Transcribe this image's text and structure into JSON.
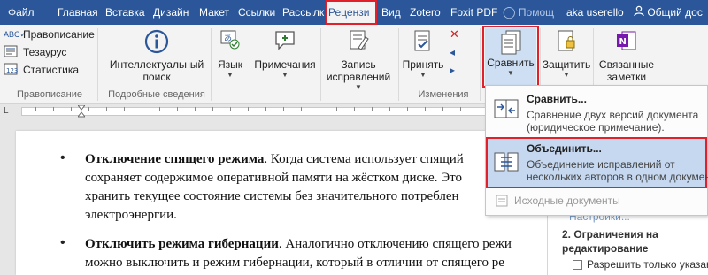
{
  "tabs": [
    {
      "label": "Файл",
      "active": false
    },
    {
      "label": "Главная",
      "active": false
    },
    {
      "label": "Вставка",
      "active": false
    },
    {
      "label": "Дизайн",
      "active": false
    },
    {
      "label": "Макет",
      "active": false
    },
    {
      "label": "Ссылки",
      "active": false
    },
    {
      "label": "Рассылк",
      "active": false
    },
    {
      "label": "Рецензи",
      "active": true
    },
    {
      "label": "Вид",
      "active": false
    },
    {
      "label": "Zotero",
      "active": false
    },
    {
      "label": "Foxit PDF",
      "active": false
    }
  ],
  "tellme_label": "Помощ",
  "user_label": "aka userello",
  "share_label": "Общий дос",
  "ribbon": {
    "proofing": {
      "spelling": "Правописание",
      "thesaurus": "Тезаурус",
      "stats": "Статистика",
      "group": "Правописание"
    },
    "insights": {
      "line1": "Интеллектуальный",
      "line2": "поиск",
      "group": "Подробные сведения"
    },
    "language": {
      "label": "Язык"
    },
    "comments": {
      "label": "Примечания"
    },
    "tracking": {
      "line1": "Запись",
      "line2": "исправлений"
    },
    "changes": {
      "accept": "Принять",
      "group": "Изменения"
    },
    "compare": {
      "label": "Сравнить"
    },
    "protect": {
      "label": "Защитить"
    },
    "onenote": {
      "line1": "Связанные",
      "line2": "заметки"
    }
  },
  "menu": {
    "compare": {
      "title": "Сравнить...",
      "desc1": "Сравнение двух версий документа",
      "desc2": "(юридическое примечание)."
    },
    "combine": {
      "title": "Объединить...",
      "desc1": "Объединение исправлений от",
      "desc2": "нескольких авторов в одном докумен"
    },
    "source": {
      "title": "Исходные документы"
    }
  },
  "doc": {
    "p1": {
      "bold": "Отключение спящего режима",
      "l1": ". Когда система использует спящий",
      "l2": "сохраняет содержимое оперативной памяти на жёстком диске. Это",
      "l3": "хранить текущее состояние системы без значительного потреблен",
      "l4": "электроэнергии."
    },
    "p2": {
      "bold": "Отключить режима гибернации",
      "l1": ". Аналогично отключению спящего режи",
      "l2": "можно выключить и режим гибернации, который в отличии от спящего ре"
    }
  },
  "nav": {
    "partial": "Настройки...",
    "heading1": "2. Ограничения на",
    "heading2": "редактирование",
    "checkbox": "Разрешить только указанн"
  },
  "colors": {
    "accent": "#2b579a",
    "highlight_outline": "#e0202a",
    "menu_hover": "#c5d8f0"
  }
}
